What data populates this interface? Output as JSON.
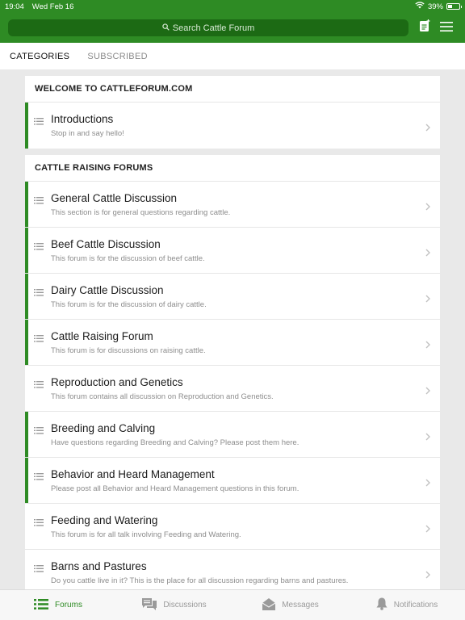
{
  "status": {
    "time": "19:04",
    "date": "Wed Feb 16",
    "battery": "39%",
    "battery_level": 0.39
  },
  "search": {
    "placeholder": "Search Cattle Forum"
  },
  "tabs": [
    {
      "label": "CATEGORIES"
    },
    {
      "label": "SUBSCRIBED"
    }
  ],
  "sections": [
    {
      "header": "WELCOME TO CATTLEFORUM.COM",
      "rows": [
        {
          "title": "Introductions",
          "desc": "Stop in and say hello!"
        }
      ]
    },
    {
      "header": "CATTLE RAISING FORUMS",
      "rows": [
        {
          "title": "General Cattle Discussion",
          "desc": "This section is for general questions regarding cattle."
        },
        {
          "title": "Beef Cattle Discussion",
          "desc": "This forum is for the discussion of beef cattle."
        },
        {
          "title": "Dairy Cattle Discussion",
          "desc": "This forum is for the discussion of dairy cattle."
        },
        {
          "title": "Cattle Raising Forum",
          "desc": "This forum is for discussions on raising cattle."
        },
        {
          "title": "Reproduction and Genetics",
          "desc": "This forum contains all discussion on Reproduction and Genetics."
        },
        {
          "title": "Breeding and Calving",
          "desc": "Have questions regarding Breeding and Calving? Please post them here."
        },
        {
          "title": "Behavior and Heard Management",
          "desc": "Please post all Behavior and Heard Management questions in this forum."
        },
        {
          "title": "Feeding and Watering",
          "desc": "This forum is for all talk involving Feeding and Watering."
        },
        {
          "title": "Barns and Pastures",
          "desc": "Do you cattle live in it? This is the place for all discussion regarding barns and pastures."
        }
      ]
    }
  ],
  "bottom_nav": [
    {
      "label": "Forums"
    },
    {
      "label": "Discussions"
    },
    {
      "label": "Messages"
    },
    {
      "label": "Notifications"
    }
  ],
  "colors": {
    "brand": "#2e8b24",
    "search_bg": "#1c6a14"
  }
}
